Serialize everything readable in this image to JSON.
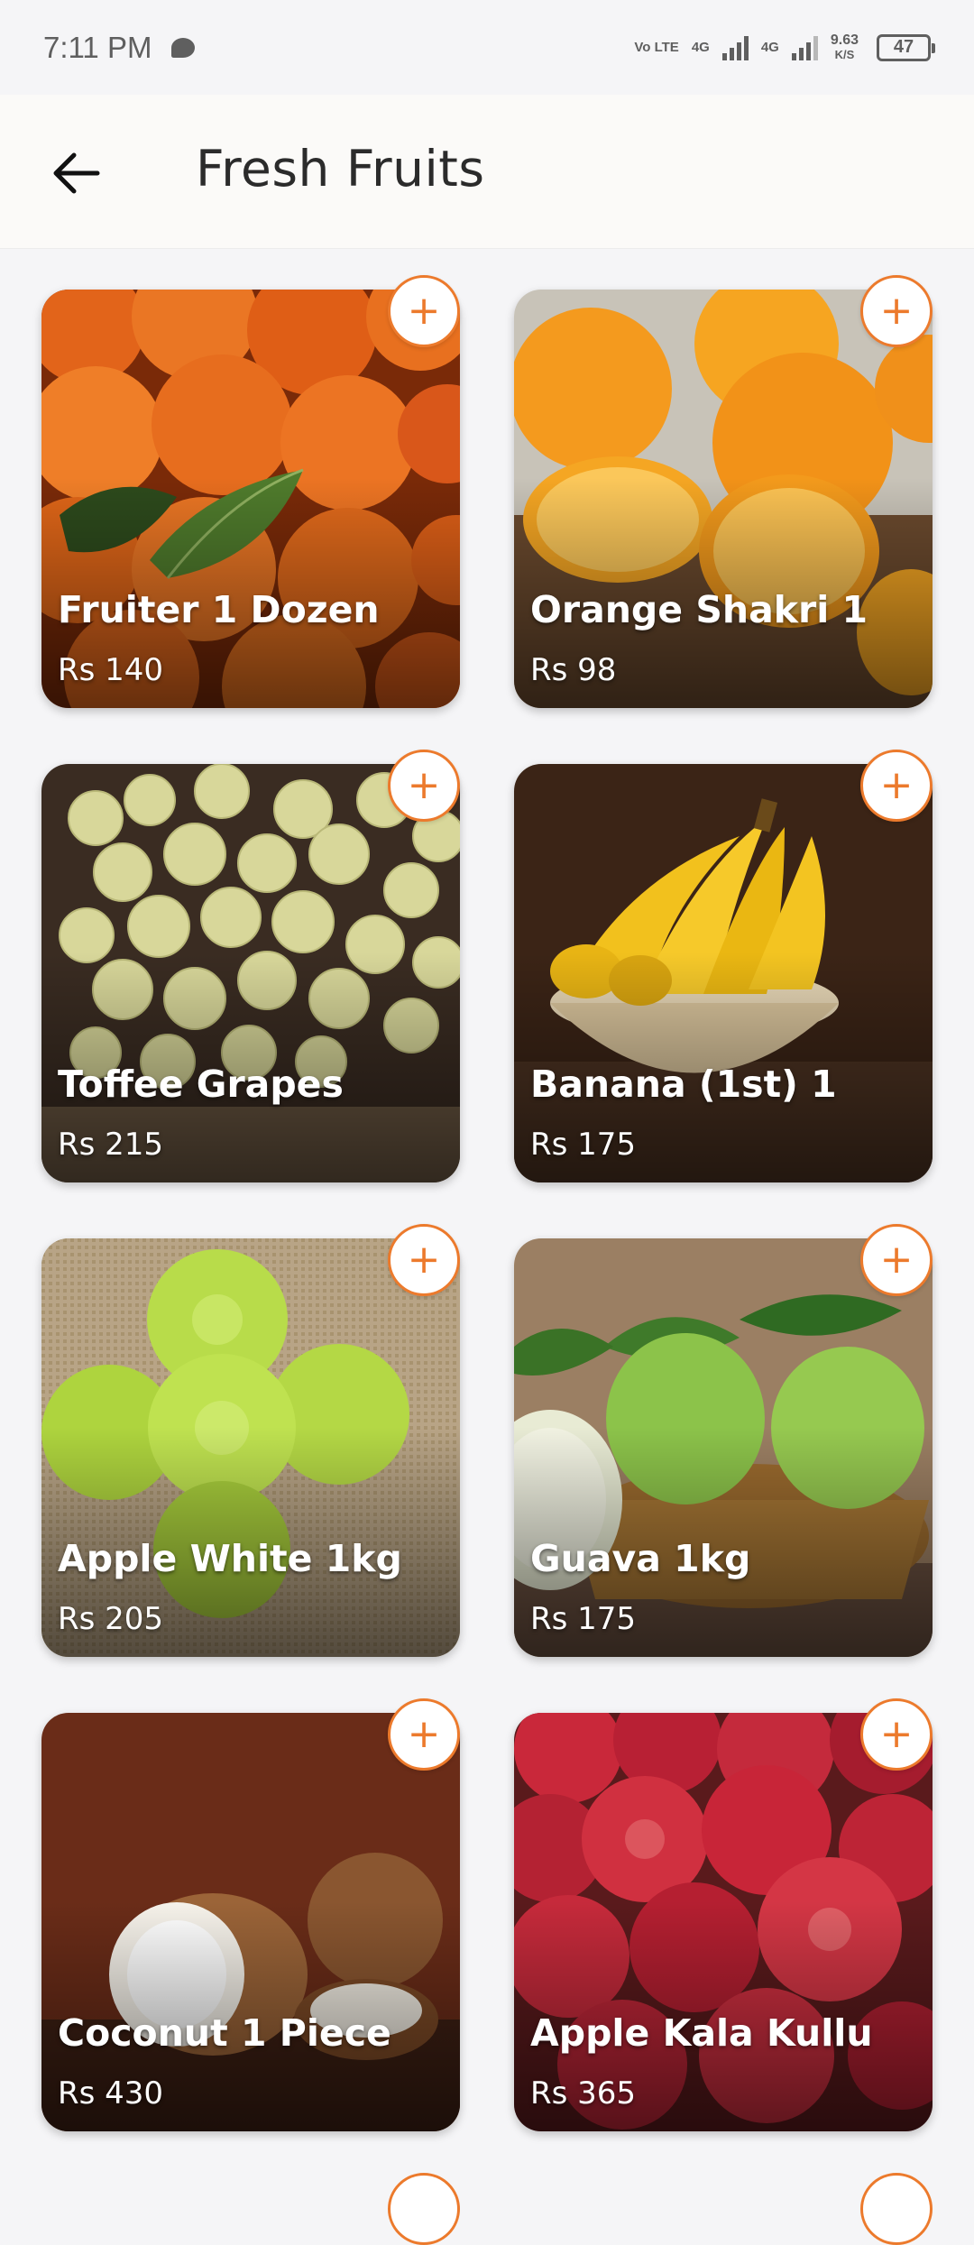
{
  "status_bar": {
    "time": "7:11 PM",
    "network_1": "Vo LTE",
    "network_2": "4G",
    "network_3": "4G",
    "speed_value": "9.63",
    "speed_unit": "K/S",
    "battery": "47"
  },
  "header": {
    "title": "Fresh Fruits",
    "back_icon": "arrow-left-icon"
  },
  "products": [
    {
      "name": "Fruiter 1 Dozen",
      "price": "Rs 140"
    },
    {
      "name": "Orange Shakri 1",
      "price": "Rs 98"
    },
    {
      "name": "Toffee Grapes",
      "price": "Rs 215"
    },
    {
      "name": "Banana (1st) 1",
      "price": "Rs 175"
    },
    {
      "name": "Apple White 1kg",
      "price": "Rs 205"
    },
    {
      "name": "Guava 1kg",
      "price": "Rs 175"
    },
    {
      "name": "Coconut 1 Piece",
      "price": "Rs 430"
    },
    {
      "name": "Apple Kala Kullu",
      "price": "Rs 365"
    }
  ],
  "add_button_symbol": "+",
  "colors": {
    "accent": "#ec7a2c",
    "background": "#f5f5f7"
  }
}
